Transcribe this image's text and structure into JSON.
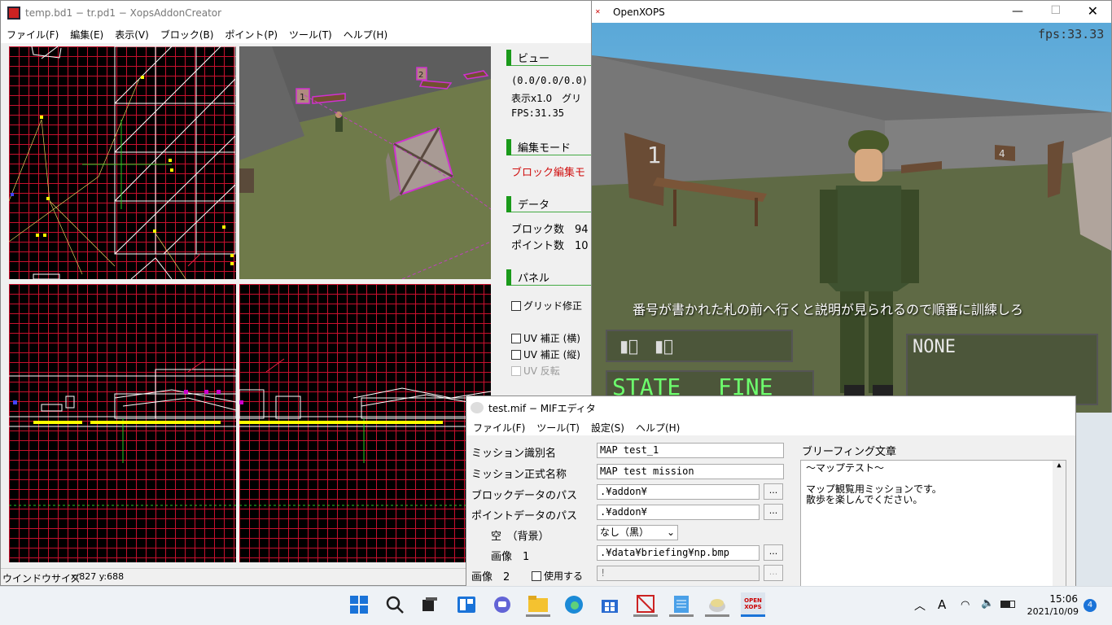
{
  "editor": {
    "title": "temp.bd1 − tr.pd1 − XopsAddonCreator",
    "menu": [
      "ファイル(F)",
      "編集(E)",
      "表示(V)",
      "ブロック(B)",
      "ポイント(P)",
      "ツール(T)",
      "ヘルプ(H)"
    ],
    "panel": {
      "view_header": "ビュー",
      "view_coords": "(0.0/0.0/0.0)",
      "view_zoom": "表示x1.0　グリ",
      "view_fps": "FPS:31.35",
      "mode_header": "編集モード",
      "mode_value": "ブロック編集モ",
      "data_header": "データ",
      "block_count": "ブロック数　94",
      "point_count": "ポイント数　10",
      "panel_header": "パネル",
      "grid_fix": "グリッド修正",
      "uv_h": "UV 補正 (横)",
      "uv_v": "UV 補正 (縦)",
      "uv_flip": "UV 反転"
    },
    "status": {
      "label": "ウインドウサイズ",
      "coords": "x:827 y:688"
    },
    "markers": [
      "1",
      "2"
    ]
  },
  "game": {
    "title": "OpenXOPS",
    "logo": "OPEN XOPS",
    "fps": "fps:33.33",
    "message": "番号が書かれた札の前へ行くと説明が見られるので順番に訓練しろ",
    "ammo": "▮⃠　▮⃠",
    "state_label": "STATE",
    "state_value": "FINE",
    "weapon": "NONE",
    "signs": [
      "1",
      "4"
    ],
    "colors": {
      "hud_text": "#6dff6d"
    }
  },
  "mif": {
    "title": "test.mif − MIFエディタ",
    "menu": [
      "ファイル(F)",
      "ツール(T)",
      "設定(S)",
      "ヘルプ(H)"
    ],
    "labels": {
      "mission_id": "ミッション識別名",
      "mission_name": "ミッション正式名称",
      "block_path": "ブロックデータのパス",
      "point_path": "ポイントデータのパス",
      "sky": "空　（背景）",
      "image1": "画像　1",
      "image2": "画像　2",
      "use": "使用する",
      "briefing": "ブリーフィング文章"
    },
    "values": {
      "mission_id": "MAP test_1",
      "mission_name": "MAP test mission",
      "block_path": ".¥addon¥",
      "point_path": ".¥addon¥",
      "sky": "なし（黒）",
      "image1": ".¥data¥briefing¥np.bmp",
      "image2": "!"
    },
    "browse": "...",
    "briefing_text": [
      "～マップテスト～",
      "",
      "マップ観覧用ミッションです。",
      "散歩を楽しんでください。"
    ]
  },
  "taskbar": {
    "icons": [
      "windows-start",
      "search",
      "task-view",
      "widgets",
      "teams-chat",
      "file-explorer",
      "edge",
      "store",
      "xops-addon-creator",
      "notepad",
      "mif-editor",
      "openxops"
    ],
    "time": "15:06",
    "date": "2021/10/09",
    "ime": "A",
    "notifications": "4"
  }
}
